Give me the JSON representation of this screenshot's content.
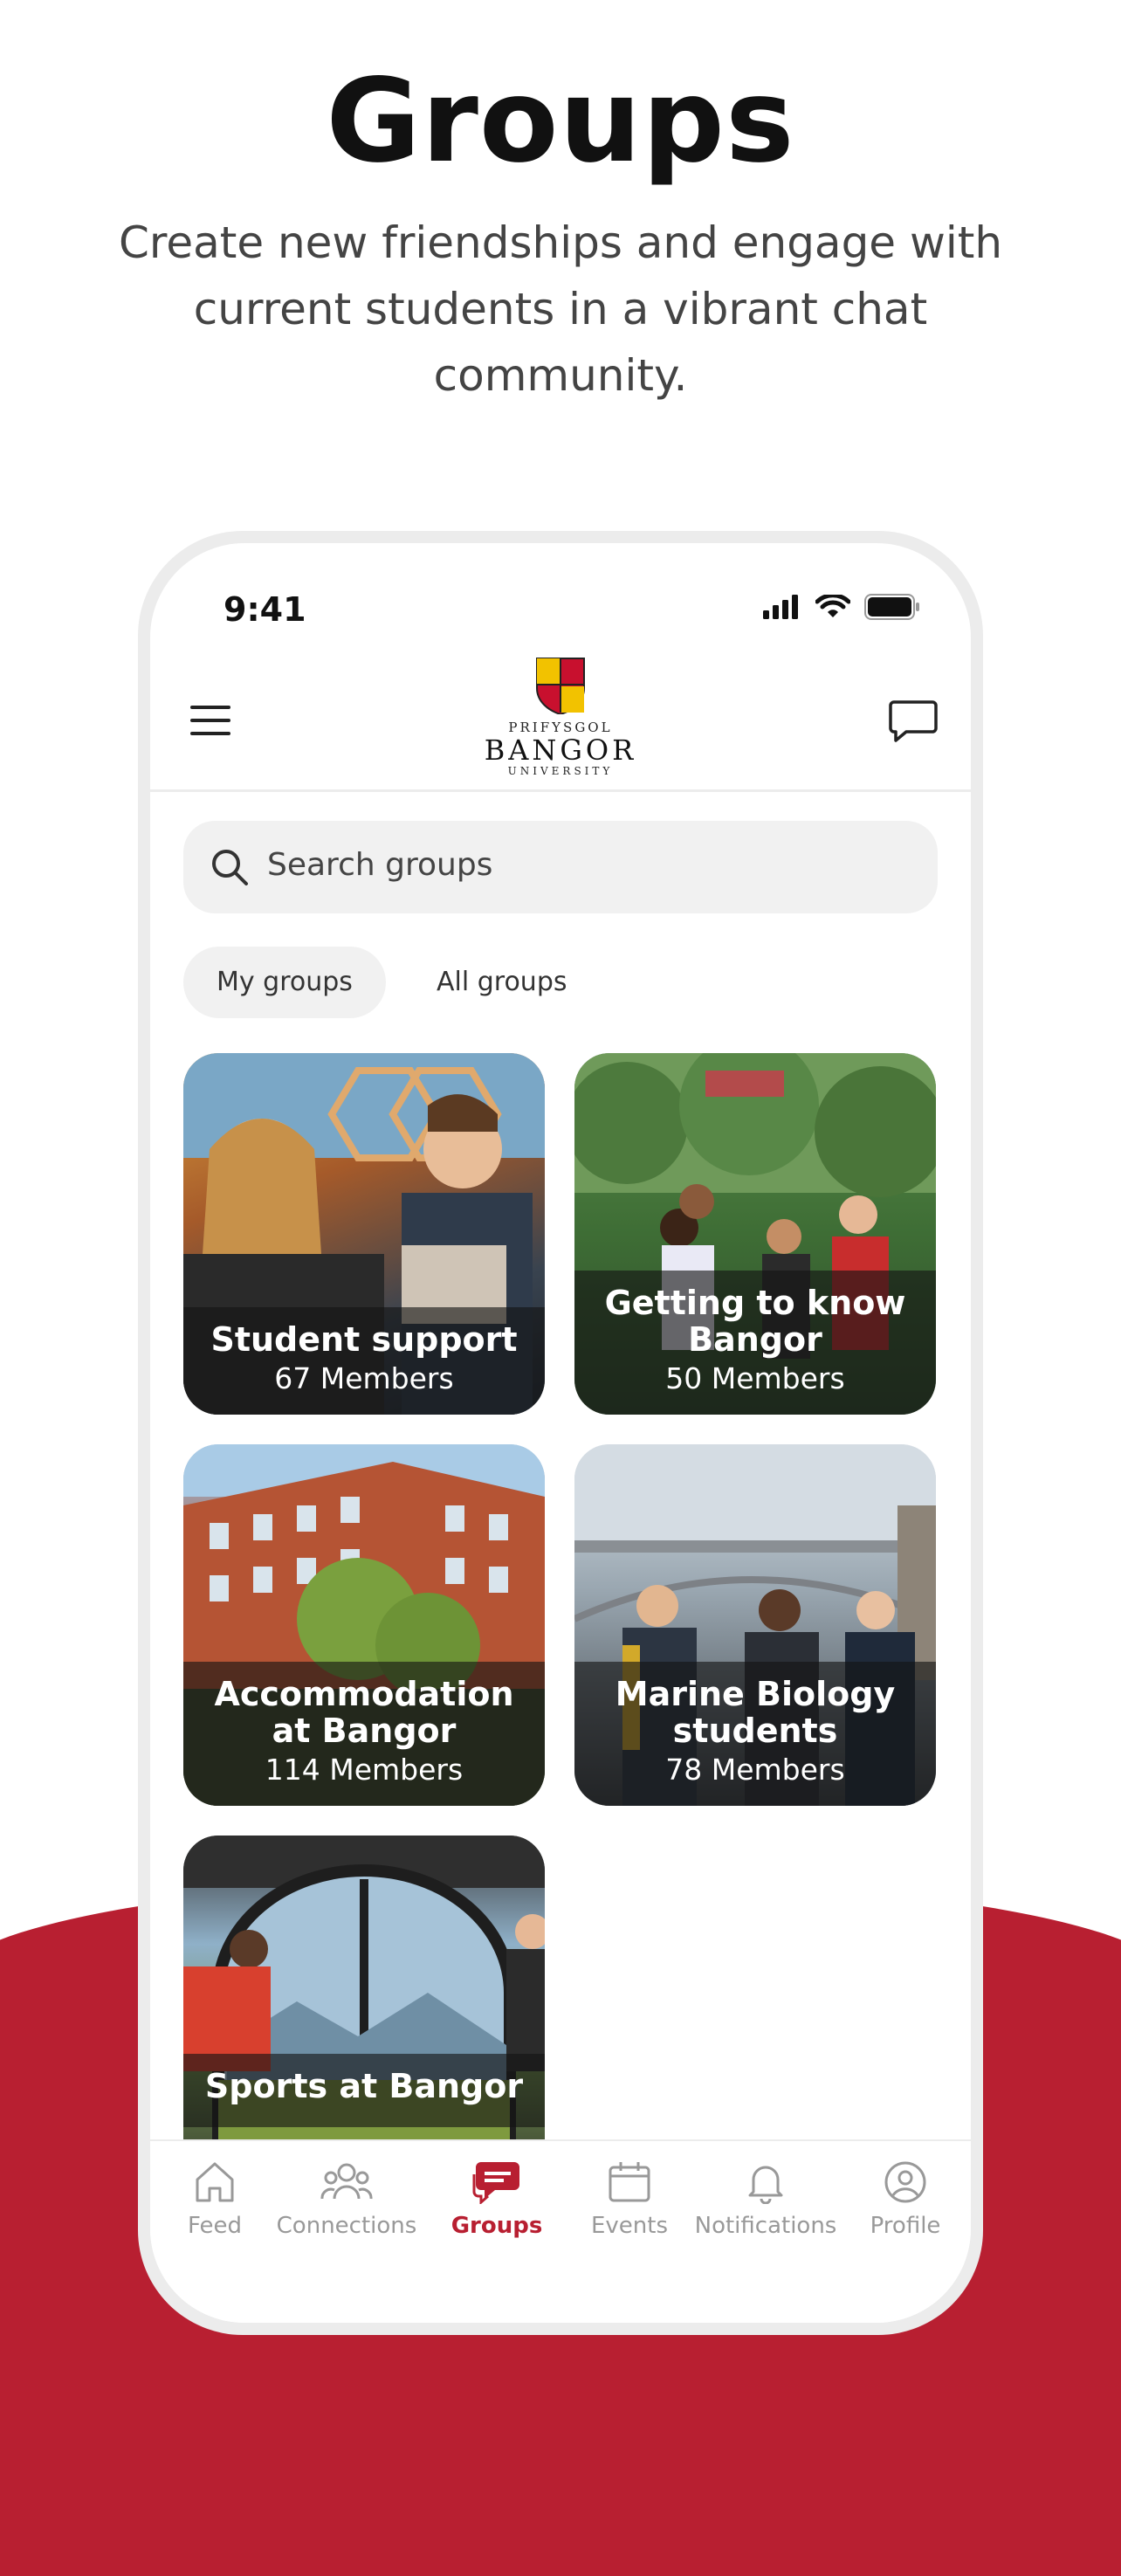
{
  "headline": "Groups",
  "subheadline": "Create new friendships and engage with current students in a vibrant chat community.",
  "status": {
    "time": "9:41"
  },
  "logo": {
    "line1": "PRIFYSGOL",
    "line2": "BANGOR",
    "line3": "UNIVERSITY"
  },
  "search": {
    "placeholder": "Search groups"
  },
  "segments": {
    "my": "My groups",
    "all": "All groups"
  },
  "groups": [
    {
      "title": "Student support",
      "members": "67 Members"
    },
    {
      "title": "Getting to know Bangor",
      "members": "50 Members"
    },
    {
      "title": "Accommodation at Bangor",
      "members": "114 Members"
    },
    {
      "title": "Marine Biology students",
      "members": "78 Members"
    },
    {
      "title": "Sports at Bangor",
      "members": ""
    }
  ],
  "tabs": [
    {
      "label": "Feed",
      "icon": "home-icon"
    },
    {
      "label": "Connections",
      "icon": "people-icon"
    },
    {
      "label": "Groups",
      "icon": "chat-bubbles-icon"
    },
    {
      "label": "Events",
      "icon": "calendar-icon"
    },
    {
      "label": "Notifications",
      "icon": "bell-icon"
    },
    {
      "label": "Profile",
      "icon": "user-circle-icon"
    }
  ],
  "colors": {
    "brand": "#b81f31",
    "text": "#111111",
    "muted": "#999999"
  }
}
